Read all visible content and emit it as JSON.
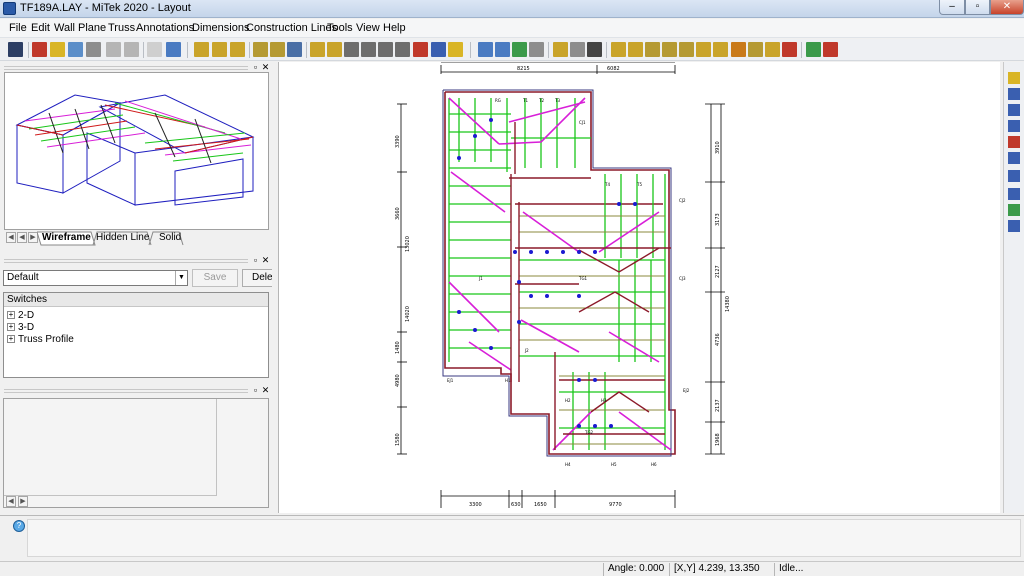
{
  "window": {
    "title": "TF189A.LAY - MiTek 2020 - Layout",
    "min": "–",
    "max": "▫",
    "close": "✕"
  },
  "menu": [
    "File",
    "Edit",
    "Wall",
    "Plane",
    "Truss",
    "Annotations",
    "Dimensions",
    "Construction Lines",
    "Tools",
    "View",
    "Help"
  ],
  "view_tabs": {
    "wireframe": "Wireframe",
    "hidden_line": "Hidden Line",
    "solid": "Solid"
  },
  "properties": {
    "preset": "Default",
    "save_label": "Save",
    "delete_label": "Delete",
    "list_header": "Switches",
    "tree": [
      "2-D",
      "3-D",
      "Truss Profile"
    ]
  },
  "drawing": {
    "top_dims": [
      "8215",
      "6082"
    ],
    "bottom_dims": [
      "3300",
      "630",
      "1650",
      "9770"
    ],
    "left_dims": [
      "3390",
      "3660",
      "13020",
      "1480",
      "14020",
      "4980",
      "1580"
    ],
    "right_dims": [
      "3910",
      "3173",
      "2127",
      "14380",
      "4736",
      "2137",
      "1968"
    ],
    "labels": [
      "RG",
      "T1",
      "T2",
      "T3",
      "T4",
      "T5",
      "CJ1",
      "CJ2",
      "CJ3",
      "J1",
      "J2",
      "H1",
      "H2",
      "H3",
      "H4",
      "H5",
      "H6",
      "TG1",
      "TG2",
      "EJ1",
      "EJ2"
    ]
  },
  "status": {
    "angle": "Angle:  0.000",
    "coords": "[X,Y] 4.239, 13.350",
    "state": "Idle..."
  },
  "colors": {
    "green": "#19c619",
    "magenta": "#d81fd8",
    "darkred": "#8c1a2a",
    "blue": "#1a1ad0",
    "olive": "#8b8a3c"
  }
}
